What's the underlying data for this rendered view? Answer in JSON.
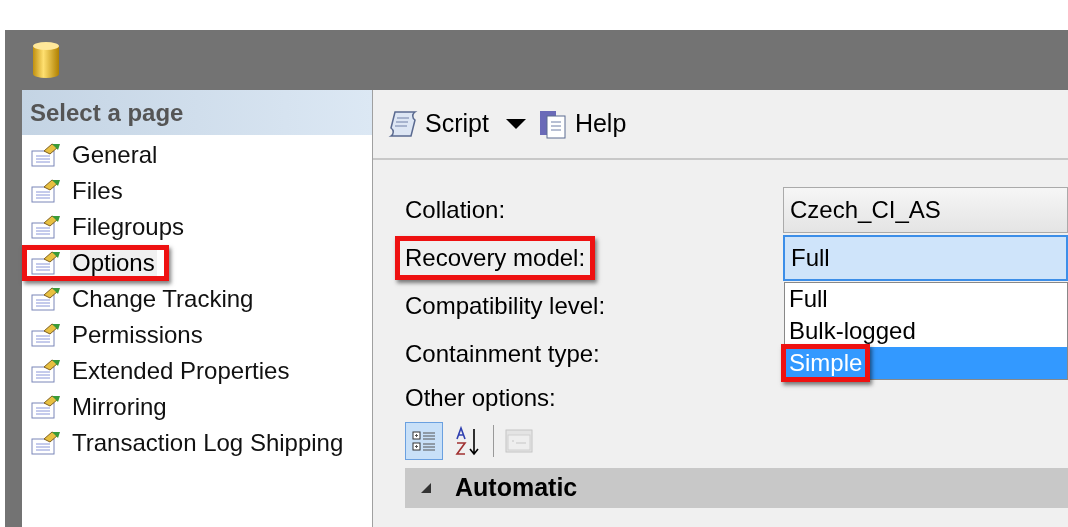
{
  "sidebar": {
    "title": "Select a page",
    "items": [
      {
        "label": "General",
        "selected": false,
        "highlighted": false
      },
      {
        "label": "Files",
        "selected": false,
        "highlighted": false
      },
      {
        "label": "Filegroups",
        "selected": false,
        "highlighted": false
      },
      {
        "label": "Options",
        "selected": true,
        "highlighted": true
      },
      {
        "label": "Change Tracking",
        "selected": false,
        "highlighted": false
      },
      {
        "label": "Permissions",
        "selected": false,
        "highlighted": false
      },
      {
        "label": "Extended Properties",
        "selected": false,
        "highlighted": false
      },
      {
        "label": "Mirroring",
        "selected": false,
        "highlighted": false
      },
      {
        "label": "Transaction Log Shipping",
        "selected": false,
        "highlighted": false
      }
    ]
  },
  "toolbar": {
    "buttons": [
      {
        "label": "Script",
        "kind": "script"
      },
      {
        "label": "Help",
        "kind": "help"
      }
    ]
  },
  "form": {
    "fields": [
      {
        "label": "Collation:",
        "value": "Czech_CI_AS",
        "highlighted": false,
        "focused": false
      },
      {
        "label": "Recovery model:",
        "value": "Full",
        "highlighted": true,
        "focused": true
      },
      {
        "label": "Compatibility level:",
        "highlighted": false
      },
      {
        "label": "Containment type:",
        "highlighted": false
      }
    ],
    "dropdown": {
      "options": [
        {
          "label": "Full",
          "selected": false,
          "highlighted": false
        },
        {
          "label": "Bulk-logged",
          "selected": false,
          "highlighted": false
        },
        {
          "label": "Simple",
          "selected": true,
          "highlighted": true
        }
      ]
    },
    "other_options_label": "Other options:",
    "grid": {
      "view_buttons": [
        {
          "kind": "categorized",
          "selected": true
        },
        {
          "kind": "alphabetical",
          "selected": false
        },
        {
          "kind": "pages",
          "selected": false
        }
      ],
      "category": {
        "label": "Automatic",
        "expanded": true
      }
    }
  }
}
